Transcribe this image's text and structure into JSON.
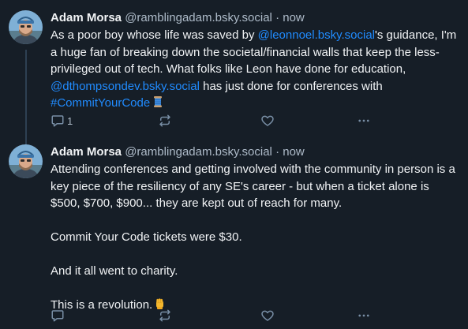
{
  "posts": [
    {
      "author_name": "Adam Morsa",
      "handle": "@ramblingadam.bsky.social",
      "separator": "·",
      "time": "now",
      "body": {
        "t1": "As a poor boy whose life was saved by ",
        "m1": "@leonnoel.bsky.social",
        "t2": "'s guidance, I'm a huge fan of breaking down the societal/financial walls that keep the less-privileged out of tech. What folks like Leon have done for education, ",
        "m2": "@dthompsondev.bsky.social",
        "t3": " has just done for conferences with ",
        "tag": "#CommitYourCode",
        "emoji": "spool-of-thread-emoji"
      },
      "actions": {
        "reply_icon": "reply-icon",
        "reply_count": "1",
        "repost_icon": "repost-icon",
        "like_icon": "heart-icon",
        "more_icon": "more-dots-icon"
      }
    },
    {
      "author_name": "Adam Morsa",
      "handle": "@ramblingadam.bsky.social",
      "separator": "·",
      "time": "now",
      "paragraphs": [
        "Attending conferences and getting involved with the community in person is a key piece of the resiliency of any SE's career - but when a ticket alone is $500, $700, $900... they are kept out of reach for many.",
        "Commit Your Code tickets were $30.",
        "And it all went to charity.",
        "This is a revolution."
      ],
      "emoji": "raised-fist-emoji",
      "actions": {
        "reply_icon": "reply-icon",
        "repost_icon": "repost-icon",
        "like_icon": "heart-icon",
        "more_icon": "more-dots-icon"
      }
    }
  ],
  "colors": {
    "background": "#161e27",
    "text": "#f1f3f5",
    "muted": "#aebbc9",
    "link": "#208bfe",
    "icon": "#788ea5",
    "thread_line": "#2e4052"
  }
}
